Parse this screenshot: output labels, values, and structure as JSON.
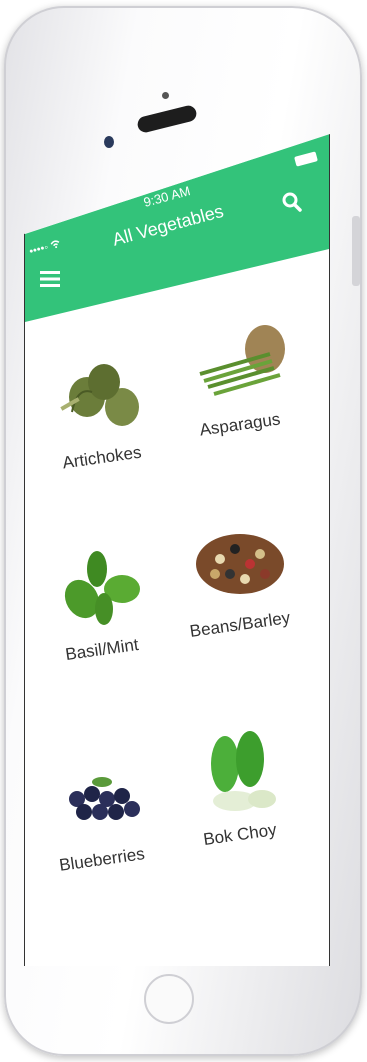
{
  "status_bar": {
    "carrier": "••••◦ ",
    "time": "9:30 AM"
  },
  "header": {
    "title": "All Vegetables"
  },
  "vegetables": [
    {
      "label": "Artichokes"
    },
    {
      "label": "Asparagus"
    },
    {
      "label": "Basil/Mint"
    },
    {
      "label": "Beans/Barley"
    },
    {
      "label": "Blueberries"
    },
    {
      "label": "Bok Choy"
    }
  ],
  "colors": {
    "header_bg": "#33c37a",
    "header_text": "#ffffff"
  },
  "icons": [
    "menu-icon",
    "search-icon",
    "list-view-icon",
    "battery-icon",
    "wifi-icon"
  ]
}
